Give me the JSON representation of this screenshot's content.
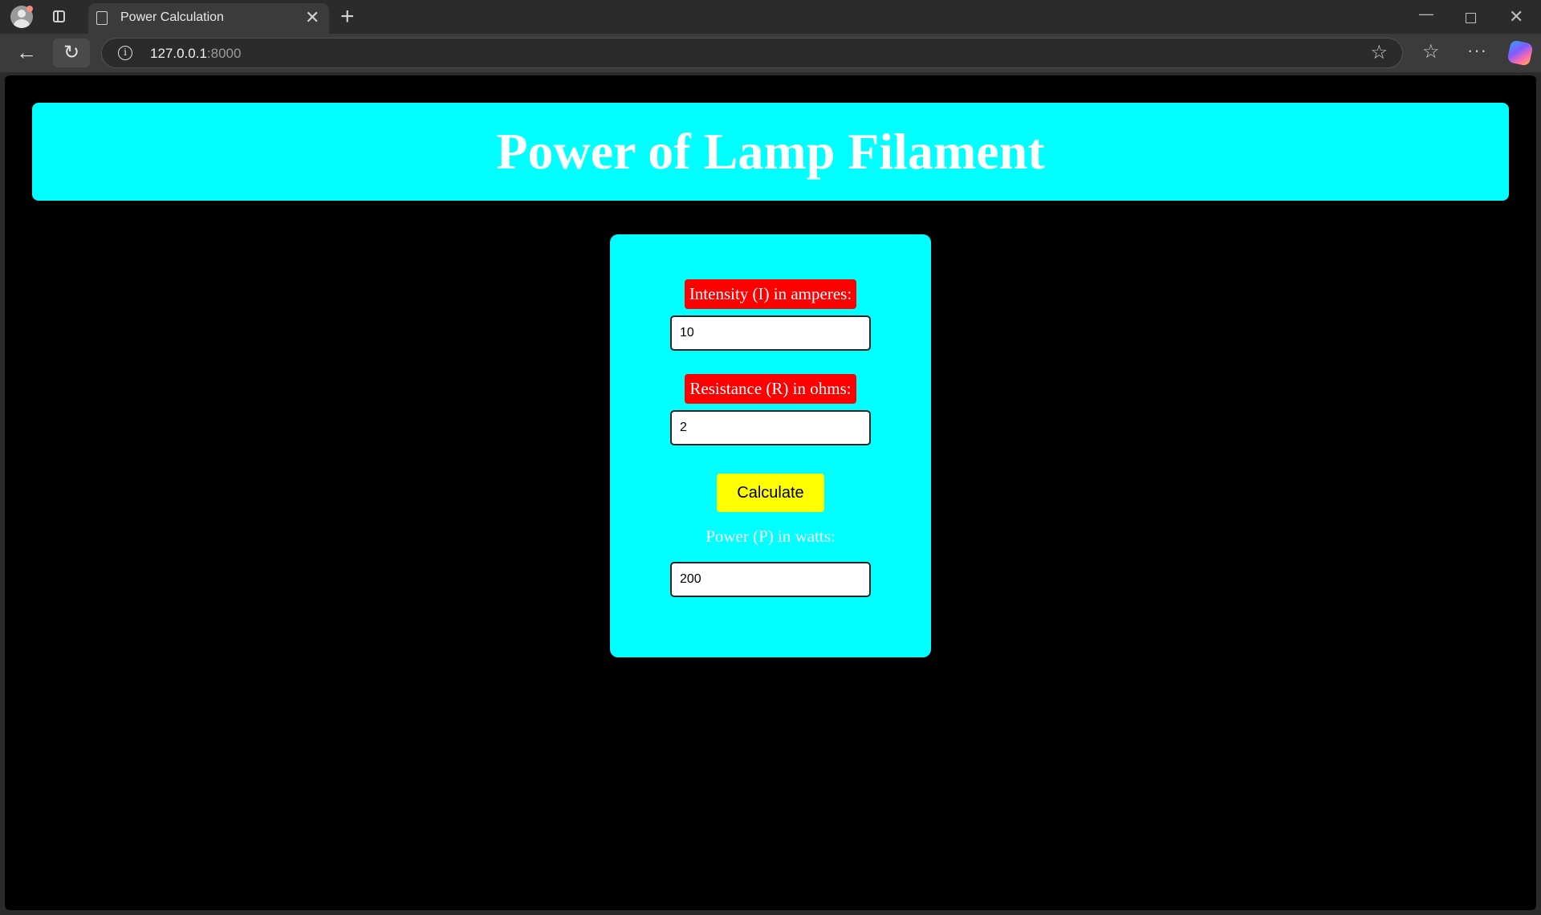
{
  "browser": {
    "tab_title": "Power Calculation",
    "new_tab_label": "+",
    "tab_close_label": "✕",
    "url_host": "127.0.0.1",
    "url_port": ":8000",
    "window_controls": {
      "minimize": "—",
      "close": "✕"
    },
    "icons": [
      "profile-icon",
      "tab-actions-icon",
      "page-icon",
      "back-icon",
      "reload-icon",
      "info-icon",
      "star-icon",
      "favorites-icon",
      "more-icon",
      "copilot-icon"
    ]
  },
  "page": {
    "heading": "Power of Lamp Filament",
    "colors": {
      "background": "#000000",
      "panel": "#00ffff",
      "label_bg": "#ff0000",
      "button_bg": "#ffff00",
      "heading_text": "#ffffff"
    },
    "form": {
      "intensity_label": "Intensity (I) in amperes:",
      "intensity_value": "10",
      "resistance_label": "Resistance (R) in ohms:",
      "resistance_value": "2",
      "calculate_label": "Calculate",
      "power_label": "Power (P) in watts:",
      "power_value": "200"
    }
  }
}
